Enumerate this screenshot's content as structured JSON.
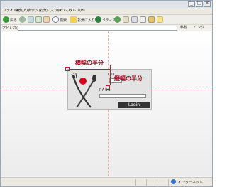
{
  "menu": {
    "items": [
      "ファイル(F)",
      "編集(E)",
      "表示(V)",
      "お気に入り(A)",
      "ツール(T)",
      "ヘルプ(H)"
    ]
  },
  "toolbar": {
    "back_label": "戻る",
    "search_label": "検索",
    "favorites_label": "お気に入り",
    "media_label": "メディア"
  },
  "address": {
    "label": "アドレス(D)",
    "value": "",
    "go_label": "移動",
    "links_label": "リンク"
  },
  "login": {
    "id_label": "I D",
    "pass_label": "PASS",
    "id_value": "",
    "pass_value": "",
    "button_label": "Login"
  },
  "annotations": {
    "half_width": "横幅の半分",
    "half_height": "縦幅の半分"
  },
  "status": {
    "zone": "インターネット"
  },
  "colors": {
    "annotation": "#c0182f",
    "guide": "#f2a7a7",
    "login_button": "#333333",
    "logo_circle": "#d8001a"
  }
}
